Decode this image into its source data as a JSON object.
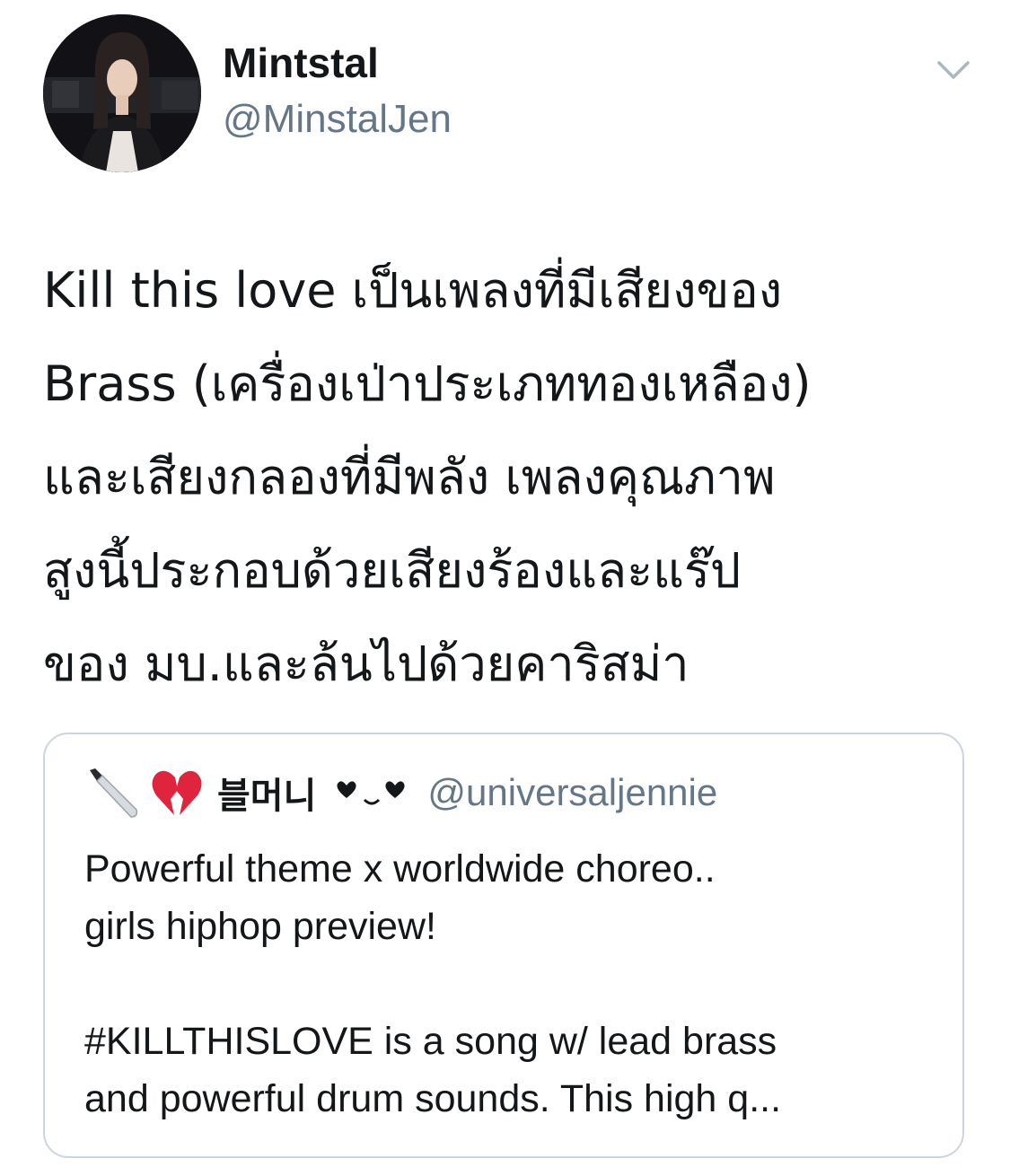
{
  "tweet": {
    "author": {
      "display_name": "Mintstal",
      "handle": "@MinstalJen",
      "avatar_icon": "profile-photo"
    },
    "menu_icon": "chevron-down-icon",
    "text_lines": [
      "Kill this love เป็นเพลงที่มีเสียงของ",
      "Brass (เครื่องเป่าประเภททองเหลือง)",
      "และเสียงกลองที่มีพลัง เพลงคุณภาพ",
      "สูงนี้ประกอบด้วยเสียงร้องและแร๊ป",
      "ของ มบ.และล้นไปด้วยคาริสม่า"
    ]
  },
  "quoted_tweet": {
    "prefix_icons": [
      "knife-emoji",
      "broken-heart-emoji"
    ],
    "display_name": "블머니",
    "name_suffix": "kaomoji-hearts",
    "handle": "@universaljennie",
    "text_lines": [
      "Powerful theme x worldwide choreo..",
      "girls hiphop preview!",
      "",
      "#KILLTHISLOVE is a song w/ lead brass",
      "and powerful drum sounds. This high q..."
    ]
  },
  "colors": {
    "text": "#14171a",
    "secondary_text": "#657786",
    "border": "#ccd6dd",
    "chevron": "#aab8c2",
    "heart_red": "#e0243d"
  }
}
